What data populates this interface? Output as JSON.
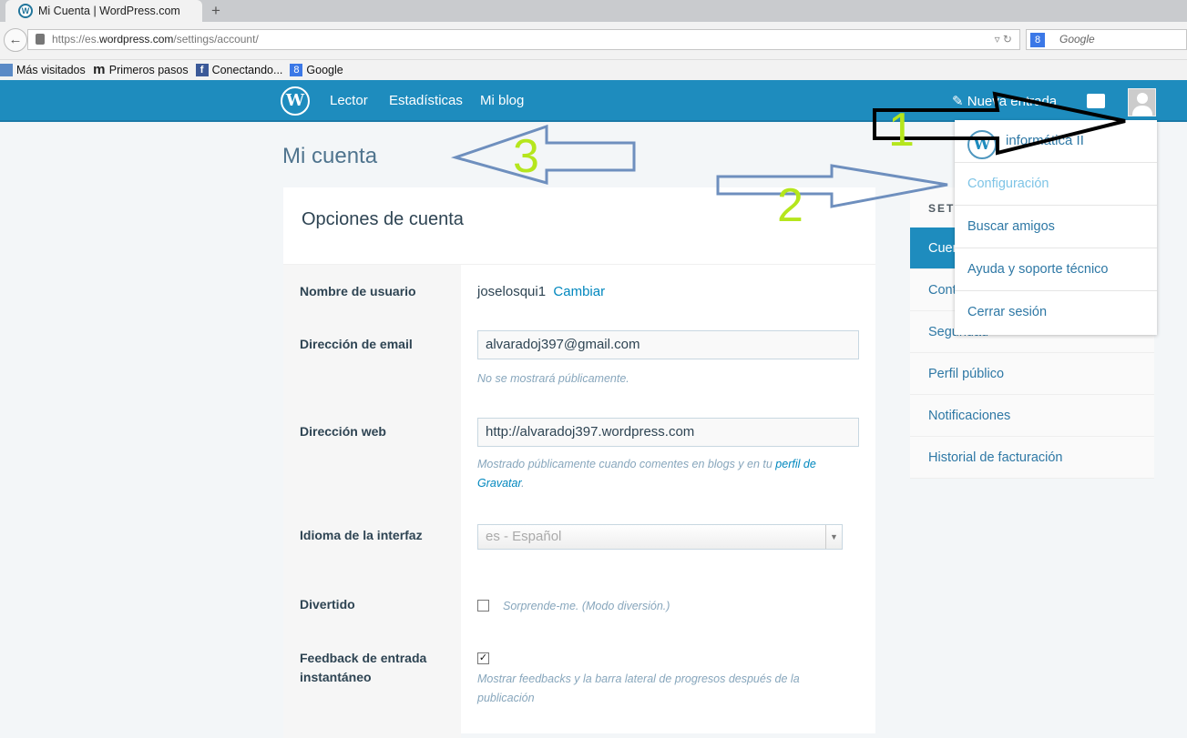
{
  "browser": {
    "tab_title": "Mi Cuenta | WordPress.com",
    "url_prefix": "https://es.",
    "url_domain": "wordpress.com",
    "url_path": "/settings/account/",
    "search_placeholder": "Google",
    "bookmarks": [
      "Más visitados",
      "Primeros pasos",
      "Conectando...",
      "Google"
    ]
  },
  "masterbar": {
    "nav": [
      "Lector",
      "Estadísticas",
      "Mi blog"
    ],
    "new_post": "Nueva entrada"
  },
  "page": {
    "title": "Mi cuenta",
    "card_title": "Opciones de cuenta"
  },
  "form": {
    "username_label": "Nombre de usuario",
    "username": "joselosqui1",
    "change_link": "Cambiar",
    "email_label": "Dirección de email",
    "email": "alvaradoj397@gmail.com",
    "email_hint": "No se mostrará públicamente.",
    "web_label": "Dirección web",
    "web": "http://alvaradoj397.wordpress.com",
    "web_hint": "Mostrado públicamente cuando comentes en blogs y en tu ",
    "web_hint_link": "perfil de Gravatar",
    "web_hint_end": ".",
    "lang_label": "Idioma de la interfaz",
    "lang": "es - Español",
    "fun_label": "Divertido",
    "fun_text": "Sorprende-me. (Modo diversión.)",
    "fun_checked": false,
    "feedback_label": "Feedback de entrada instantáneo",
    "feedback_text": "Mostrar feedbacks y la barra lateral de progresos después de la publicación",
    "feedback_checked": true
  },
  "sidebar": {
    "heading": "SETTINGS",
    "items": [
      "Cuenta",
      "Contraseña",
      "Seguridad",
      "Perfil público",
      "Notificaciones",
      "Historial de facturación"
    ]
  },
  "dropdown": {
    "site": "informática II",
    "items": [
      "Configuración",
      "Buscar amigos",
      "Ayuda y soporte técnico",
      "Cerrar sesión"
    ]
  },
  "annotations": {
    "n1": "1",
    "n2": "2",
    "n3": "3"
  }
}
